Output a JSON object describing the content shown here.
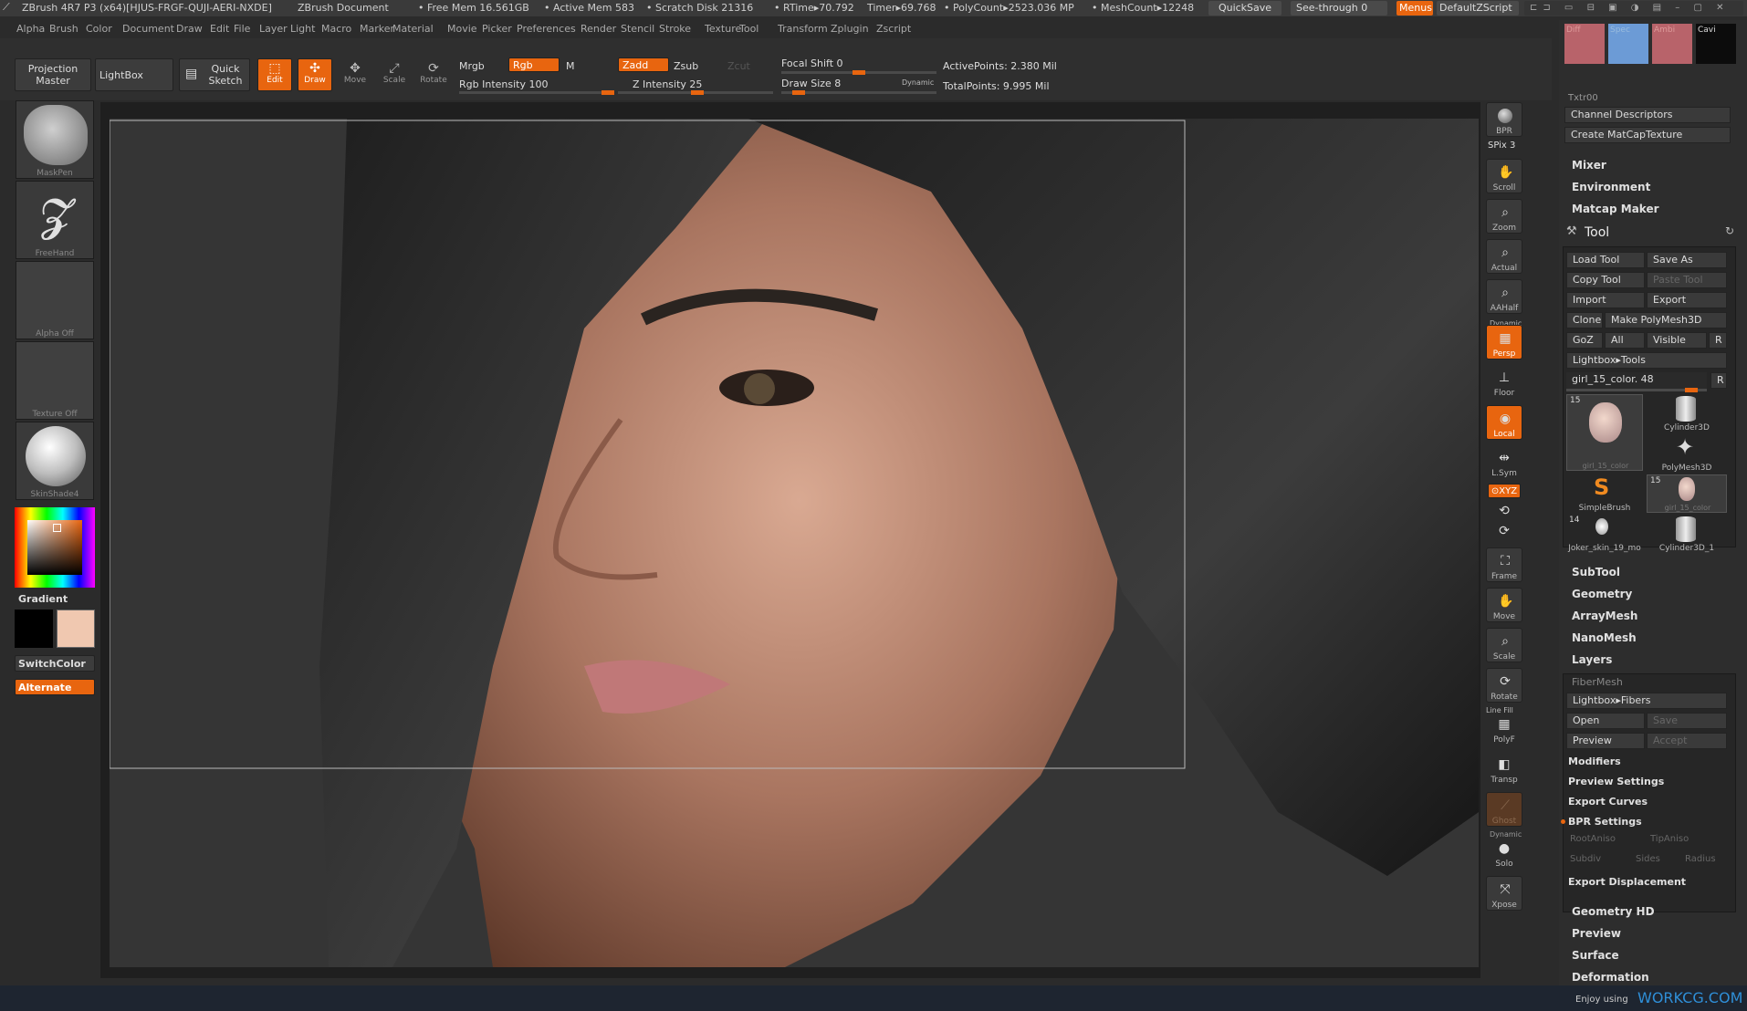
{
  "titlebar": {
    "app": "ZBrush 4R7 P3 (x64)[HJUS-FRGF-QUJI-AERI-NXDE]",
    "document": "ZBrush Document",
    "free_mem": "• Free Mem 16.561GB",
    "active_mem": "• Active Mem 583",
    "scratch": "• Scratch Disk 21316",
    "rtime": "• RTime▸70.792",
    "timer": "Timer▸69.768",
    "polycount": "• PolyCount▸2523.036 MP",
    "meshcount": "• MeshCount▸12248",
    "quicksave": "QuickSave",
    "seethrough": "See-through  0",
    "menus": "Menus",
    "script": "DefaultZScript"
  },
  "menubar": [
    "Alpha",
    "Brush",
    "Color",
    "Document",
    "Draw",
    "Edit",
    "File",
    "Layer",
    "Light",
    "Macro",
    "Marker",
    "Material",
    "Movie",
    "Picker",
    "Preferences",
    "Render",
    "Stencil",
    "Stroke",
    "Texture",
    "Tool",
    "Transform",
    "Zplugin",
    "Zscript"
  ],
  "toolbar": {
    "projection_master": "Projection Master",
    "lightbox": "LightBox",
    "quick_sketch": "Quick Sketch",
    "edit": "Edit",
    "draw": "Draw",
    "move": "Move",
    "scale": "Scale",
    "rotate": "Rotate",
    "mrgb": "Mrgb",
    "rgb": "Rgb",
    "m": "M",
    "rgb_intensity": "Rgb Intensity 100",
    "zadd": "Zadd",
    "zsub": "Zsub",
    "zcut": "Zcut",
    "z_intensity": "Z Intensity 25",
    "focal_shift": "Focal Shift 0",
    "draw_size": "Draw Size 8",
    "dynamic": "Dynamic",
    "active_points": "ActivePoints: 2.380 Mil",
    "total_points": "TotalPoints: 9.995 Mil"
  },
  "leftshelf": {
    "brush": "MaskPen",
    "stroke": "FreeHand",
    "alpha": "Alpha Off",
    "texture": "Texture Off",
    "material": "SkinShade4",
    "gradient": "Gradient",
    "switchcolor": "SwitchColor",
    "alternate": "Alternate",
    "colors": {
      "secondary": "#000000",
      "primary": "#f0c8b0"
    }
  },
  "rightshelf": {
    "bpr": "BPR",
    "spix": "SPix 3",
    "scroll": "Scroll",
    "zoom": "Zoom",
    "actual": "Actual",
    "aahalf": "AAHalf",
    "dynamic": "Dynamic",
    "persp": "Persp",
    "floor": "Floor",
    "local": "Local",
    "lsym": "L.Sym",
    "xyz": "⊙XYZ",
    "frame": "Frame",
    "move": "Move",
    "scale": "Scale",
    "rotate": "Rotate",
    "linefill": "Line Fill",
    "polyf": "PolyF",
    "transp": "Transp",
    "ghost": "Ghost",
    "dynamic2": "Dynamic",
    "solo": "Solo",
    "xpose": "Xpose"
  },
  "palette": {
    "swatches": [
      "Diff",
      "Spec",
      "Ambi",
      "Cavi"
    ],
    "swatch_colors": [
      "#b8636a",
      "#6c9bd6",
      "#b8636a",
      "#0c0c0c"
    ],
    "txtr": "Txtr00",
    "channel_descriptors": "Channel Descriptors",
    "create_matcap": "Create MatCapTexture",
    "mixer": "Mixer",
    "environment": "Environment",
    "matcap_maker": "Matcap Maker",
    "tool_header": "Tool",
    "load_tool": "Load Tool",
    "save_as": "Save As",
    "copy_tool": "Copy Tool",
    "paste_tool": "Paste Tool",
    "import": "Import",
    "export": "Export",
    "clone": "Clone",
    "make_polymesh": "Make PolyMesh3D",
    "goz": "GoZ",
    "all": "All",
    "visible": "Visible",
    "r": "R",
    "lightbox_tools": "Lightbox▸Tools",
    "current_tool": "girl_15_color. 48",
    "tools": [
      {
        "count": "15",
        "name": "girl_15_color"
      },
      {
        "count": "",
        "name": "Cylinder3D"
      },
      {
        "count": "",
        "name": "PolyMesh3D"
      },
      {
        "count": "",
        "name": "SimpleBrush"
      },
      {
        "count": "15",
        "name": "girl_15_color"
      },
      {
        "count": "14",
        "name": "Joker_skin_19_mo"
      },
      {
        "count": "",
        "name": "Cylinder3D_1"
      }
    ],
    "subtool": "SubTool",
    "geometry": "Geometry",
    "arraymesh": "ArrayMesh",
    "nanomesh": "NanoMesh",
    "layers": "Layers",
    "fibermesh": "FiberMesh",
    "lightbox_fibers": "Lightbox▸Fibers",
    "open": "Open",
    "save": "Save",
    "preview": "Preview",
    "accept": "Accept",
    "modifiers": "Modifiers",
    "preview_settings": "Preview Settings",
    "export_curves": "Export Curves",
    "bpr_settings": "BPR Settings",
    "rootaniso": "RootAniso",
    "tipaniso": "TipAniso",
    "subdiv": "Subdiv",
    "sides": "Sides",
    "radius": "Radius",
    "export_displacement": "Export Displacement",
    "geometry_hd": "Geometry HD",
    "preview2": "Preview",
    "surface": "Surface",
    "deformation": "Deformation"
  },
  "watermark": {
    "prefix": "Enjoy using",
    "site": "WORKCG.COM"
  }
}
